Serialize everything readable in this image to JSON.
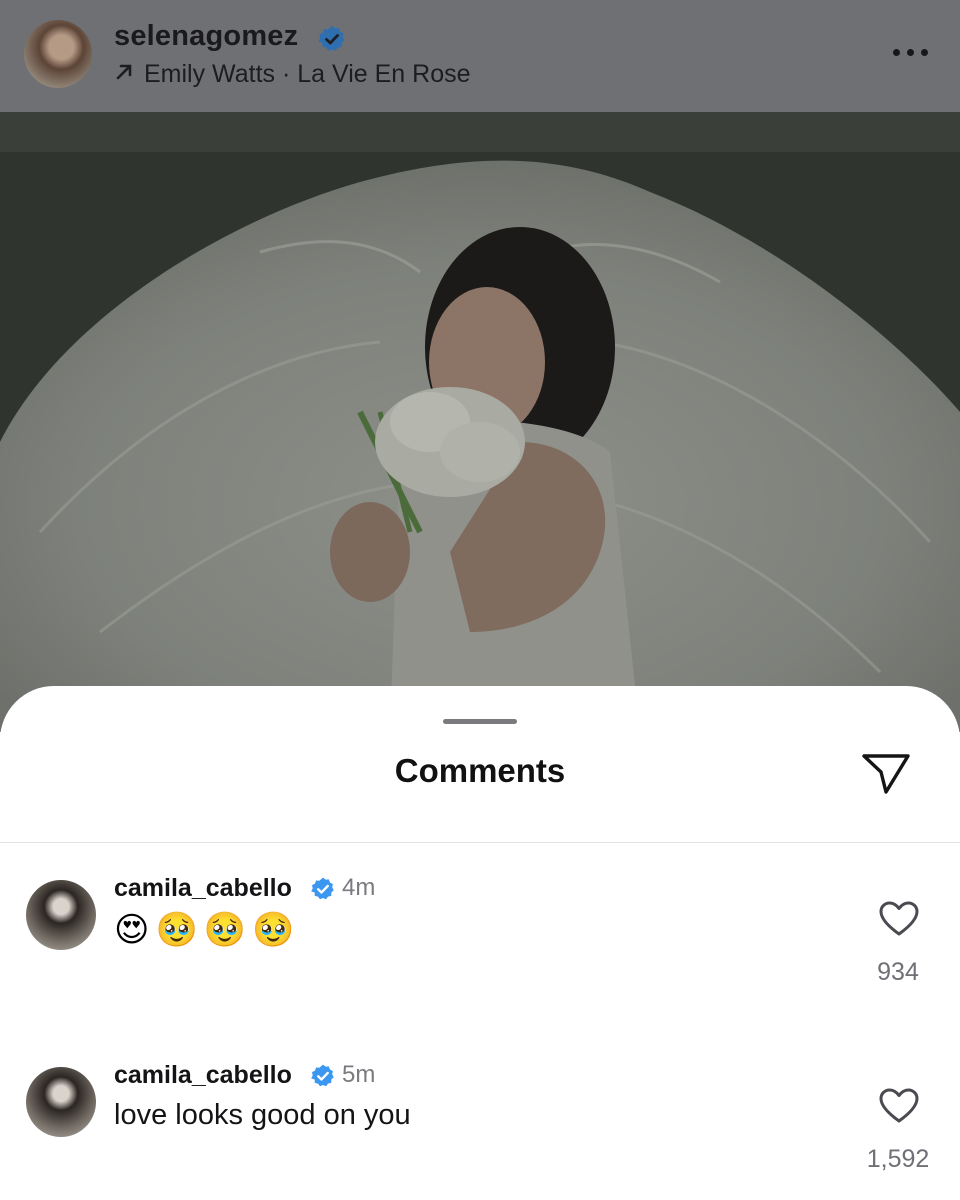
{
  "post": {
    "username": "selenagomez",
    "verified": true,
    "audio_line": "Emily Watts · La Vie En Rose",
    "icons": {
      "audio": "arrow-up-right-icon",
      "more": "more-horizontal-icon",
      "verified": "verified-badge-icon"
    }
  },
  "comments_sheet": {
    "title": "Comments",
    "share_icon": "send-icon",
    "items": [
      {
        "username": "camila_cabello",
        "verified": true,
        "time": "4m",
        "text": "😍🥹🥹🥹",
        "likes": "934",
        "like_icon": "heart-outline-icon"
      },
      {
        "username": "camila_cabello",
        "verified": true,
        "time": "5m",
        "text": "love looks good on you",
        "likes": "1,592",
        "like_icon": "heart-outline-icon"
      }
    ]
  },
  "colors": {
    "verified_blue": "#3b97f0",
    "dim_overlay": "#6f7073",
    "muted_text": "#7a7a80"
  }
}
